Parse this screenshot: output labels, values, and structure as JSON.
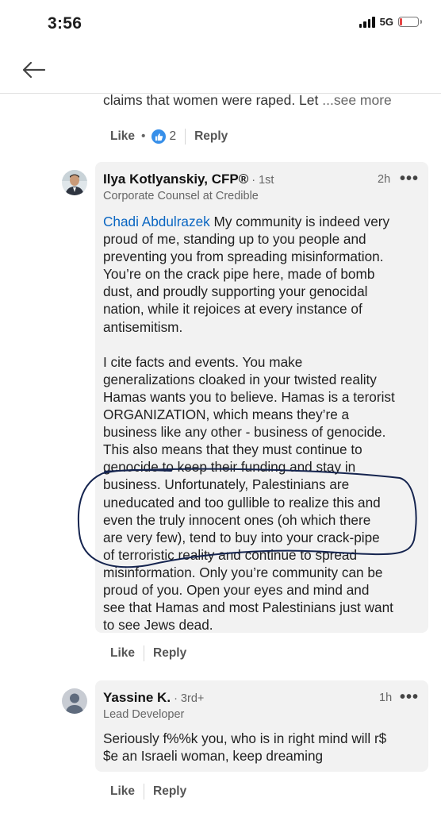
{
  "status_bar": {
    "time": "3:56",
    "network": "5G",
    "battery_level_percent": 10
  },
  "nav": {
    "back_icon": "arrow-left-icon"
  },
  "previous_comment": {
    "text_tail": "claims that women were raped. Let ",
    "see_more": "...see more",
    "actions": {
      "like": "Like",
      "reaction_count": "2",
      "reply": "Reply"
    }
  },
  "comment_1": {
    "author": "Ilya Kotlyanskiy, CFP®",
    "degree": "· 1st",
    "headline": "Corporate Counsel at Credible",
    "time": "2h",
    "more_icon": "ellipsis-icon",
    "mention": "Chadi Abdulrazek",
    "para1_lines": [
      " My community is indeed very",
      "proud of me, standing up to you people and",
      "preventing you from spreading misinformation.",
      "You’re on the crack pipe here, made of bomb",
      "dust, and proudly supporting your genocidal",
      "nation, while it rejoices at every instance of",
      "antisemitism."
    ],
    "para2_lines": [
      "I cite facts and events. You make",
      "generalizations cloaked in your twisted reality",
      "Hamas wants you to believe. Hamas is a terorist",
      "ORGANIZATION, which means they’re a",
      "business like any other - business of genocide.",
      "This also means that they must continue to",
      "genocide to keep their funding and stay in",
      "business. Unfortunately, Palestinians are",
      "uneducated and too gullible to realize this and",
      "even the truly innocent ones (oh which there",
      "are very few), tend to buy into your crack-pipe",
      "of terroristic reality and continue to spread",
      "misinformation. Only you’re community can be",
      "proud of you. Open your eyes and mind and",
      "see that Hamas and most Palestinians just want",
      "to see Jews dead."
    ],
    "actions": {
      "like": "Like",
      "reply": "Reply"
    }
  },
  "comment_2": {
    "author": "Yassine K.",
    "degree": "· 3rd+",
    "headline": "Lead Developer",
    "time": "1h",
    "more_icon": "ellipsis-icon",
    "body_lines": [
      "Seriously f%%k you, who is in right mind will r$",
      "$e an Israeli woman, keep dreaming"
    ],
    "actions": {
      "like": "Like",
      "reply": "Reply"
    }
  },
  "colors": {
    "link_blue": "#0a66c2",
    "card_bg": "#f2f2f2",
    "reaction_blue": "#378fe9",
    "annotation_ink": "#15244f"
  }
}
